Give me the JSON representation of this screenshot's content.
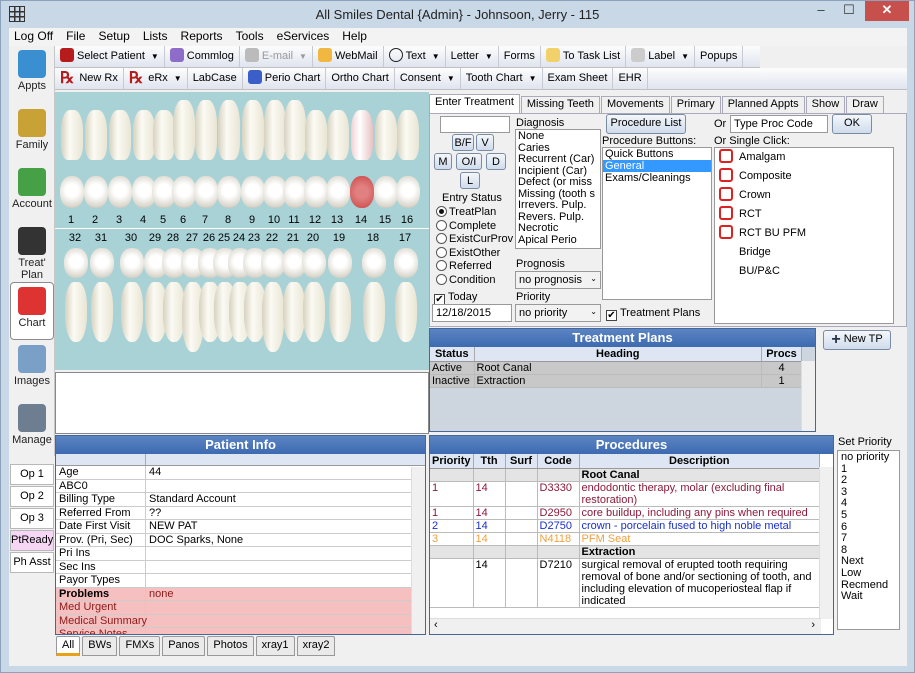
{
  "window": {
    "title": "All Smiles Dental {Admin} - Johnsoon, Jerry - 115",
    "minimize": "–",
    "maximize": "☐",
    "close": "✕"
  },
  "menu": [
    "Log Off",
    "File",
    "Setup",
    "Lists",
    "Reports",
    "Tools",
    "eServices",
    "Help"
  ],
  "toolbar1": [
    {
      "label": "Select Patient",
      "icon": "select-patient-icon",
      "dropdown": true
    },
    {
      "label": "Commlog",
      "icon": "commlog-icon",
      "dropdown": false
    },
    {
      "label": "E-mail",
      "icon": "email-icon",
      "dropdown": true,
      "disabled": true
    },
    {
      "label": "WebMail",
      "icon": "webmail-icon",
      "dropdown": false
    },
    {
      "label": "Text",
      "icon": "text-bubble-icon",
      "dropdown": true
    },
    {
      "label": "Letter",
      "icon": "",
      "dropdown": true
    },
    {
      "label": "Forms",
      "icon": "",
      "dropdown": false
    },
    {
      "label": "To Task List",
      "icon": "task-list-icon",
      "dropdown": false
    },
    {
      "label": "Label",
      "icon": "label-icon",
      "dropdown": true
    },
    {
      "label": "Popups",
      "icon": "",
      "dropdown": false
    }
  ],
  "toolbar2": [
    {
      "label": "New Rx",
      "icon": "rx-icon",
      "dropdown": false
    },
    {
      "label": "eRx",
      "icon": "rx-icon",
      "dropdown": true
    },
    {
      "label": "LabCase",
      "icon": "",
      "dropdown": false
    },
    {
      "label": "Perio Chart",
      "icon": "perio-chart-icon",
      "dropdown": false
    },
    {
      "label": "Ortho Chart",
      "icon": "",
      "dropdown": false
    },
    {
      "label": "Consent",
      "icon": "",
      "dropdown": true
    },
    {
      "label": "Tooth Chart",
      "icon": "",
      "dropdown": true
    },
    {
      "label": "Exam Sheet",
      "icon": "",
      "dropdown": false
    },
    {
      "label": "EHR",
      "icon": "",
      "dropdown": false
    }
  ],
  "outlook": [
    {
      "label": "Appts",
      "icon": "appointments-icon"
    },
    {
      "label": "Family",
      "icon": "family-icon"
    },
    {
      "label": "Account",
      "icon": "account-icon"
    },
    {
      "label": "Treat' Plan",
      "icon": "treatment-plan-icon"
    },
    {
      "label": "Chart",
      "icon": "chart-tooth-icon",
      "selected": true
    },
    {
      "label": "Images",
      "icon": "images-icon"
    },
    {
      "label": "Manage",
      "icon": "manage-gears-icon"
    }
  ],
  "ops": [
    {
      "label": "Op 1"
    },
    {
      "label": "Op 2"
    },
    {
      "label": "Op 3"
    },
    {
      "label": "PtReady",
      "highlight": "#f5d6f5"
    },
    {
      "label": "Ph Asst"
    }
  ],
  "tooth_chart": {
    "upper_numbers": [
      "1",
      "2",
      "3",
      "4",
      "5",
      "6",
      "7",
      "8",
      "9",
      "10",
      "11",
      "12",
      "13",
      "14",
      "15",
      "16"
    ],
    "lower_numbers": [
      "32",
      "31",
      "30",
      "29",
      "28",
      "27",
      "26",
      "25",
      "24",
      "23",
      "22",
      "21",
      "20",
      "19",
      "18",
      "17"
    ],
    "highlighted_tooth": "14",
    "highlight_color": "#d9534f"
  },
  "treatment": {
    "tabs": [
      "Enter Treatment",
      "Missing Teeth",
      "Movements",
      "Primary",
      "Planned Appts",
      "Show",
      "Draw"
    ],
    "surface_input": "",
    "surface_buttons": [
      "B/F",
      "V",
      "M",
      "O/I",
      "D",
      "L"
    ],
    "diagnosis_label": "Diagnosis",
    "diagnosis": [
      "None",
      "Caries",
      "Recurrent (Car)",
      "Incipient (Car)",
      "Defect (or miss",
      "Missing (tooth s",
      "Irrevers. Pulp.",
      "Revers. Pulp.",
      "Necrotic",
      "Apical Perio"
    ],
    "entry_status_label": "Entry Status",
    "entry_status": [
      "TreatPlan",
      "Complete",
      "ExistCurProv",
      "ExistOther",
      "Referred",
      "Condition"
    ],
    "entry_status_selected": "TreatPlan",
    "today_label": "Today",
    "today_checked": true,
    "date": "12/18/2015",
    "prognosis_label": "Prognosis",
    "prognosis_value": "no prognosis",
    "priority_label": "Priority",
    "priority_value": "no priority",
    "procedure_list_button": "Procedure List",
    "procedure_buttons_label": "Procedure Buttons:",
    "procedure_button_categories": [
      "Quick Buttons",
      "General",
      "Exams/Cleanings"
    ],
    "procedure_button_selected": "General",
    "or_label": "Or",
    "proc_code_input": "Type Proc Code",
    "ok_button": "OK",
    "single_click_label": "Or Single Click:",
    "single_click": [
      {
        "label": "Amalgam",
        "icon": "amalgam-icon"
      },
      {
        "label": "Composite",
        "icon": "composite-icon"
      },
      {
        "label": "Crown",
        "icon": "crown-icon"
      },
      {
        "label": "RCT",
        "icon": "rct-icon"
      },
      {
        "label": "RCT BU PFM",
        "icon": "rct-bu-pfm-icon"
      },
      {
        "label": "Bridge",
        "icon": ""
      },
      {
        "label": "BU/P&C",
        "icon": ""
      }
    ],
    "treatment_plans_check": "Treatment Plans",
    "treatment_plans_checked": true
  },
  "treatment_plans": {
    "title": "Treatment Plans",
    "new_button": "New TP",
    "columns": [
      "Status",
      "Heading",
      "Procs"
    ],
    "rows": [
      [
        "Active",
        "Root Canal",
        "4"
      ],
      [
        "Inactive",
        "Extraction",
        "1"
      ]
    ]
  },
  "patient_info": {
    "title": "Patient Info",
    "rows": [
      {
        "k": "Age",
        "v": "44"
      },
      {
        "k": "ABC0",
        "v": ""
      },
      {
        "k": "Billing Type",
        "v": "Standard Account"
      },
      {
        "k": "Referred From",
        "v": "??"
      },
      {
        "k": "Date First Visit",
        "v": "NEW PAT"
      },
      {
        "k": "Prov. (Pri, Sec)",
        "v": "DOC Sparks, None"
      },
      {
        "k": "Pri Ins",
        "v": ""
      },
      {
        "k": "Sec Ins",
        "v": ""
      },
      {
        "k": "Payor Types",
        "v": ""
      },
      {
        "k": "Problems",
        "v": "none",
        "pink": true,
        "bold": true
      },
      {
        "k": "Med Urgent",
        "v": "",
        "pink": true
      },
      {
        "k": "Medical Summary",
        "v": "",
        "pink": true
      },
      {
        "k": "Service Notes",
        "v": "",
        "pink": true
      }
    ]
  },
  "procedures": {
    "title": "Procedures",
    "columns": [
      "Priority",
      "Tth",
      "Surf",
      "Code",
      "Description"
    ],
    "groups": [
      {
        "heading": "Root Canal",
        "rows": [
          {
            "priority": "1",
            "tth": "14",
            "surf": "",
            "code": "D3330",
            "desc": "endodontic therapy, molar (excluding final restoration)",
            "color": "#8b1a3a"
          },
          {
            "priority": "1",
            "tth": "14",
            "surf": "",
            "code": "D2950",
            "desc": "core buildup, including any pins when required",
            "color": "#8b1a3a"
          },
          {
            "priority": "2",
            "tth": "14",
            "surf": "",
            "code": "D2750",
            "desc": "crown - porcelain fused to high noble metal",
            "color": "#1a2fcc"
          },
          {
            "priority": "3",
            "tth": "14",
            "surf": "",
            "code": "N4118",
            "desc": "PFM Seat",
            "color": "#f0a040"
          }
        ]
      },
      {
        "heading": "Extraction",
        "rows": [
          {
            "priority": "",
            "tth": "14",
            "surf": "",
            "code": "D7210",
            "desc": "surgical removal of erupted tooth requiring removal of bone and/or sectioning of tooth, and including elevation of mucoperiosteal flap if indicated",
            "color": "#000000"
          }
        ]
      }
    ]
  },
  "set_priority": {
    "label": "Set Priority",
    "options": [
      "no priority",
      "1",
      "2",
      "3",
      "4",
      "5",
      "6",
      "7",
      "8",
      "Next",
      "Low",
      "Recmend",
      "Wait"
    ]
  },
  "image_tabs": [
    "All",
    "BWs",
    "FMXs",
    "Panos",
    "Photos",
    "xray1",
    "xray2"
  ],
  "image_tab_selected": "All"
}
